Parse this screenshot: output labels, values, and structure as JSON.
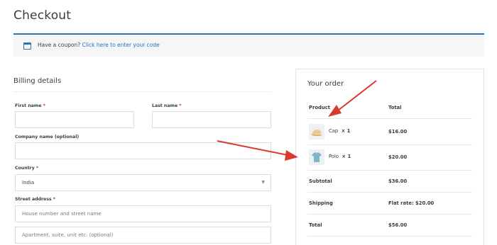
{
  "page": {
    "title": "Checkout"
  },
  "coupon": {
    "prefix": "Have a coupon?",
    "link": "Click here to enter your code"
  },
  "billing": {
    "title": "Billing details",
    "first_name": {
      "label": "First name",
      "req": "*",
      "value": ""
    },
    "last_name": {
      "label": "Last name",
      "req": "*",
      "value": ""
    },
    "company": {
      "label": "Company name (optional)",
      "value": ""
    },
    "country": {
      "label": "Country",
      "req": "*",
      "value": "India"
    },
    "street": {
      "label": "Street address",
      "req": "*",
      "placeholder1": "House number and street name",
      "placeholder2": "Apartment, suite, unit etc. (optional)"
    }
  },
  "order": {
    "title": "Your order",
    "col_product": "Product",
    "col_total": "Total",
    "items": [
      {
        "name": "Cap",
        "qty": "× 1",
        "total": "$16.00",
        "icon": "cap-icon"
      },
      {
        "name": "Polo",
        "qty": "× 1",
        "total": "$20.00",
        "icon": "polo-shirt-icon"
      }
    ],
    "subtotal": {
      "label": "Subtotal",
      "value": "$36.00"
    },
    "shipping": {
      "label": "Shipping",
      "value": "Flat rate: $20.00"
    },
    "total": {
      "label": "Total",
      "value": "$56.00"
    }
  },
  "colors": {
    "accent": "#2d72b3",
    "required": "#d12f2f",
    "annotation": "#d93a2b"
  }
}
